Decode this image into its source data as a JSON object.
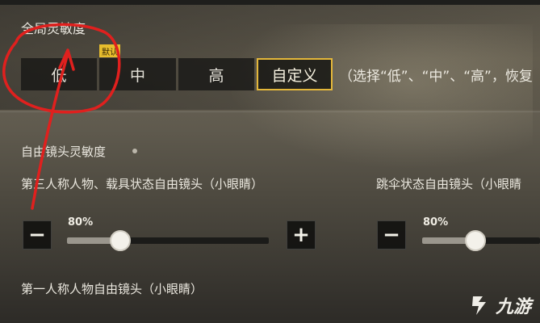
{
  "global_sensitivity": {
    "title": "全局灵敏度",
    "default_badge": "默认",
    "options": [
      "低",
      "中",
      "高",
      "自定义"
    ],
    "selected": "自定义",
    "hint": "（选择“低”、“中”、“高”，恢复"
  },
  "free_camera": {
    "title": "自由镜头灵敏度",
    "items": [
      {
        "label": "第三人称人物、载具状态自由镜头（小眼睛）",
        "value_text": "80%",
        "value": 0.8,
        "minus": "−",
        "plus": "+"
      },
      {
        "label": "跳伞状态自由镜头（小眼睛",
        "value_text": "80%",
        "value": 0.8,
        "minus": "−"
      }
    ],
    "next_label": "第一人称人物自由镜头（小眼睛）"
  },
  "watermark": {
    "text": "九游"
  },
  "colors": {
    "accent": "#e4b73a",
    "annotation": "#e0201e"
  }
}
